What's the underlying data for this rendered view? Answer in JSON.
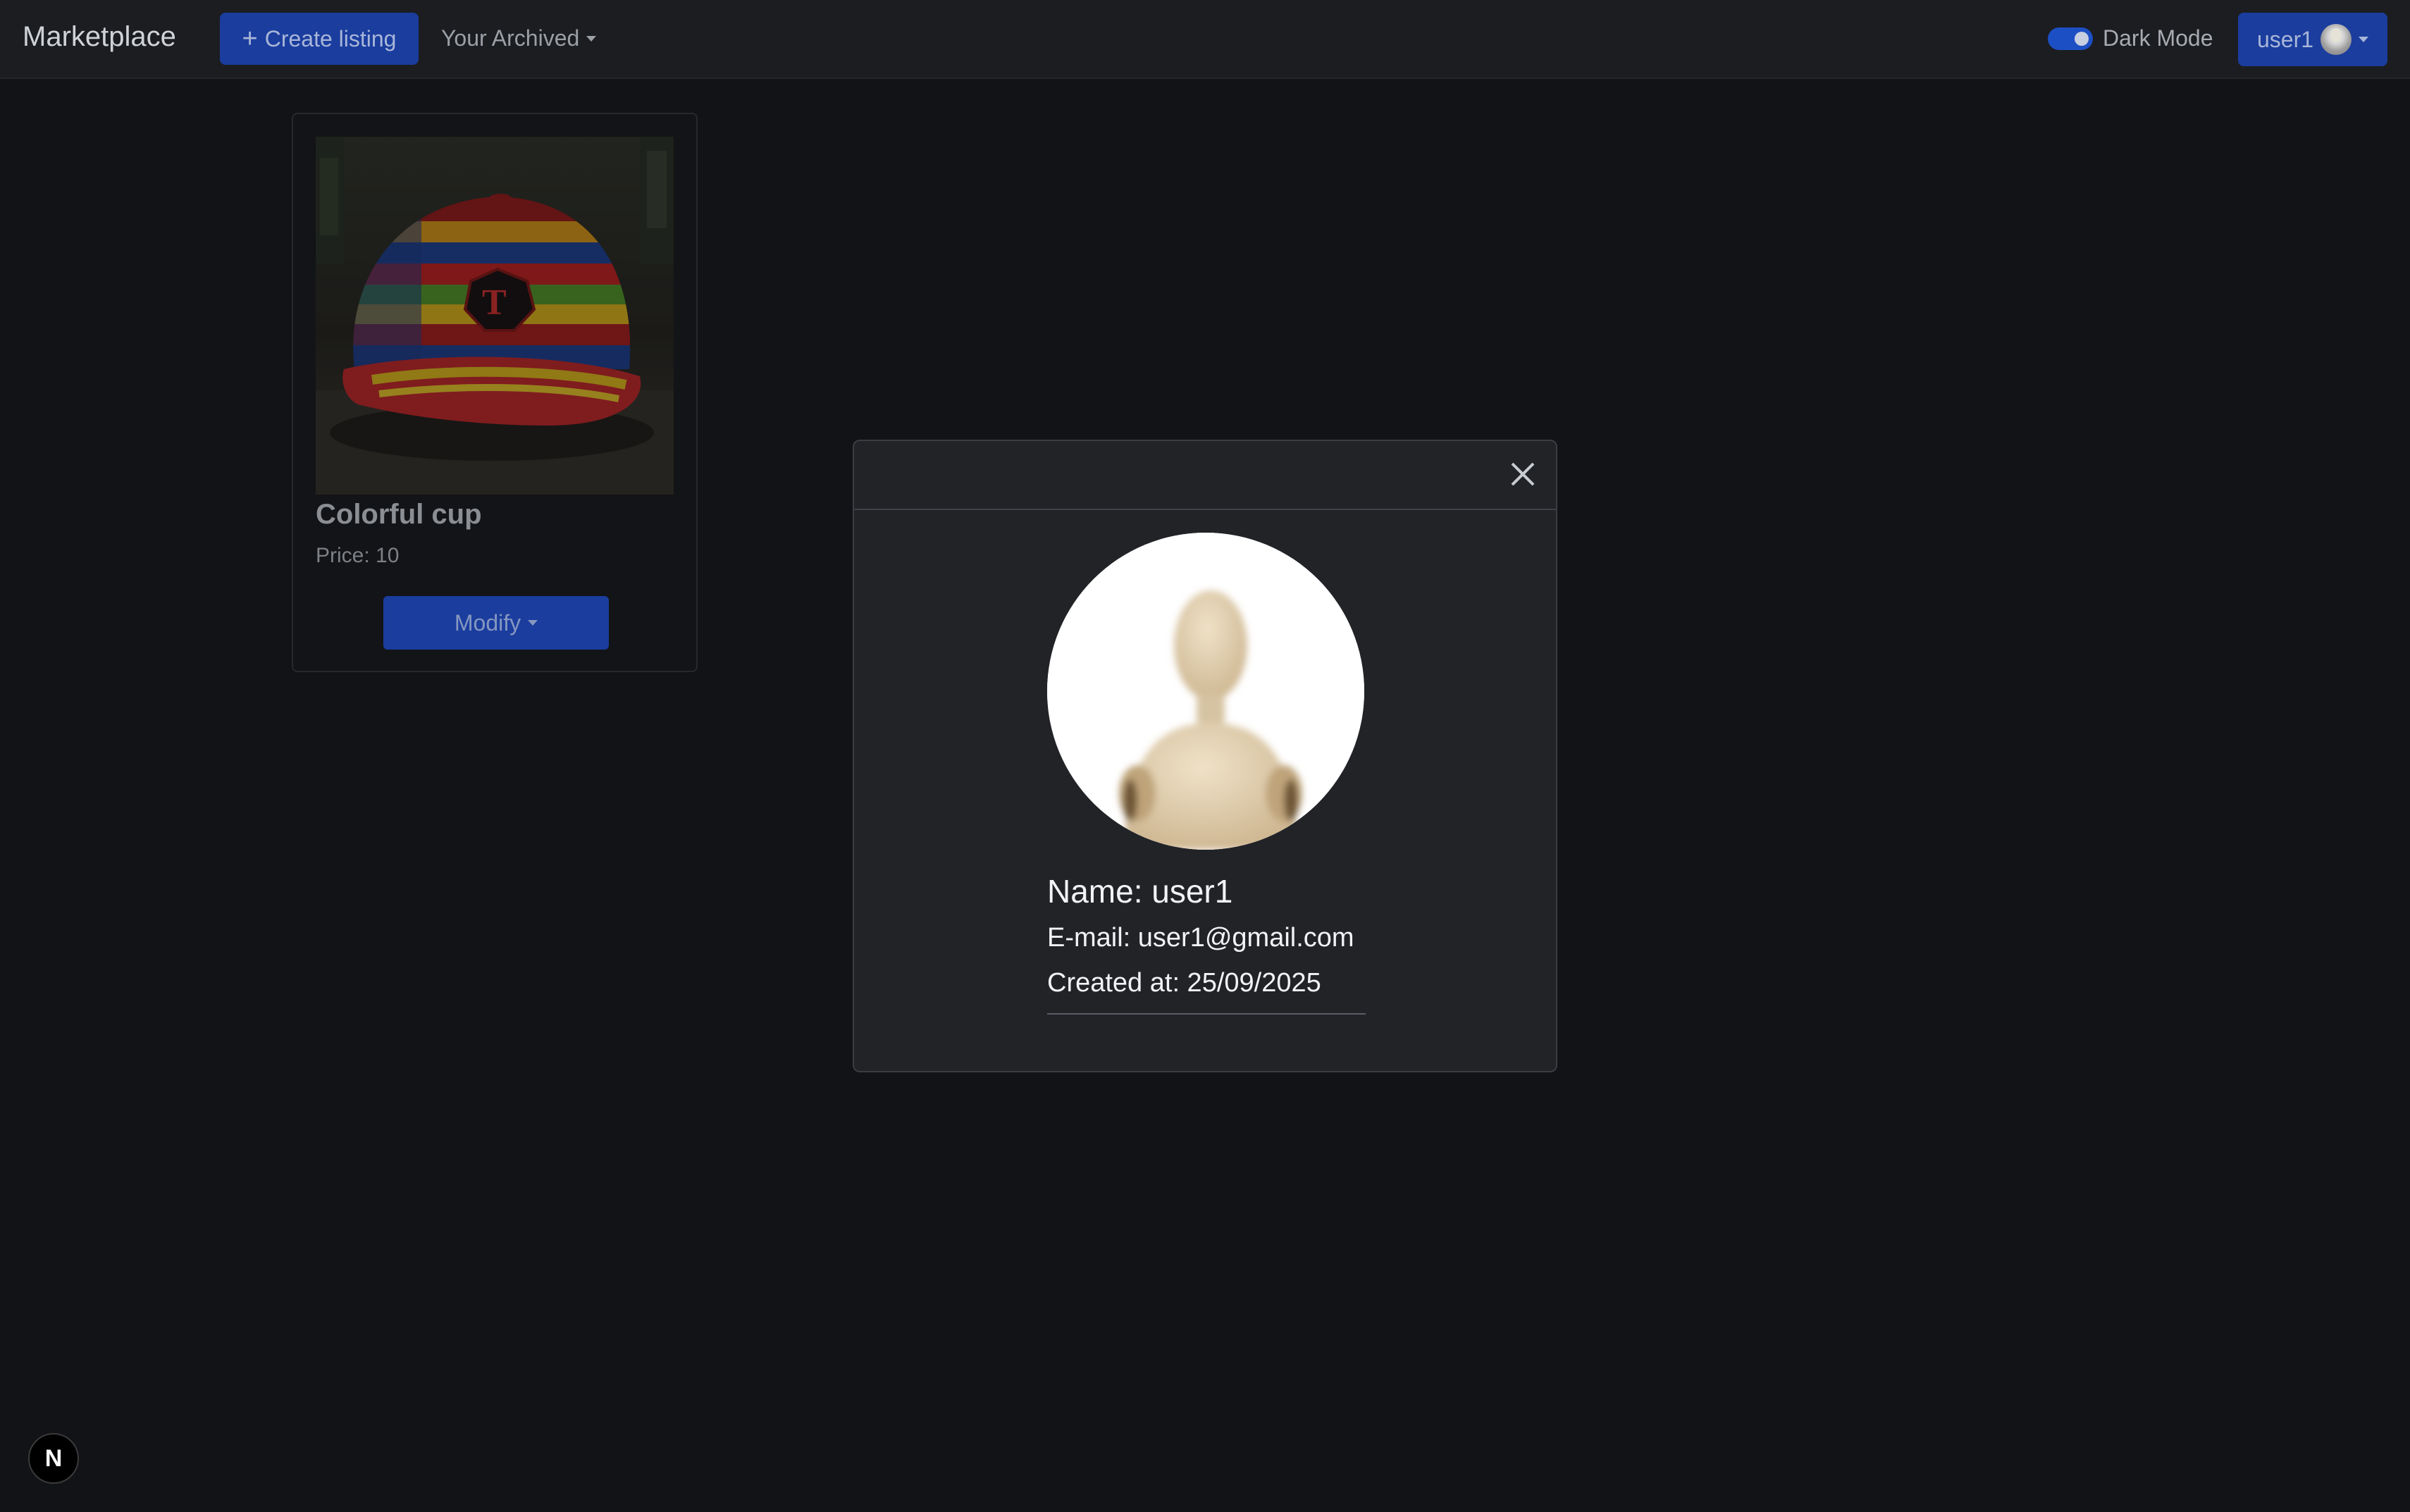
{
  "navbar": {
    "brand": "Marketplace",
    "create_listing_label": "Create listing",
    "archived_label": "Your Archived",
    "dark_mode_label": "Dark Mode",
    "dark_mode_enabled": true,
    "user_label": "user1"
  },
  "listing": {
    "title": "Colorful cup",
    "price_text": "Price: 10",
    "modify_label": "Modify"
  },
  "profile_modal": {
    "name_text": "Name: user1",
    "email_text": "E-mail: user1@gmail.com",
    "created_text": "Created at: 25/09/2025"
  },
  "badge": {
    "letter": "N"
  },
  "colors": {
    "background": "#121316",
    "navbar": "#1c1d21",
    "primary_button": "#1a3d9e",
    "modal": "#212327"
  }
}
